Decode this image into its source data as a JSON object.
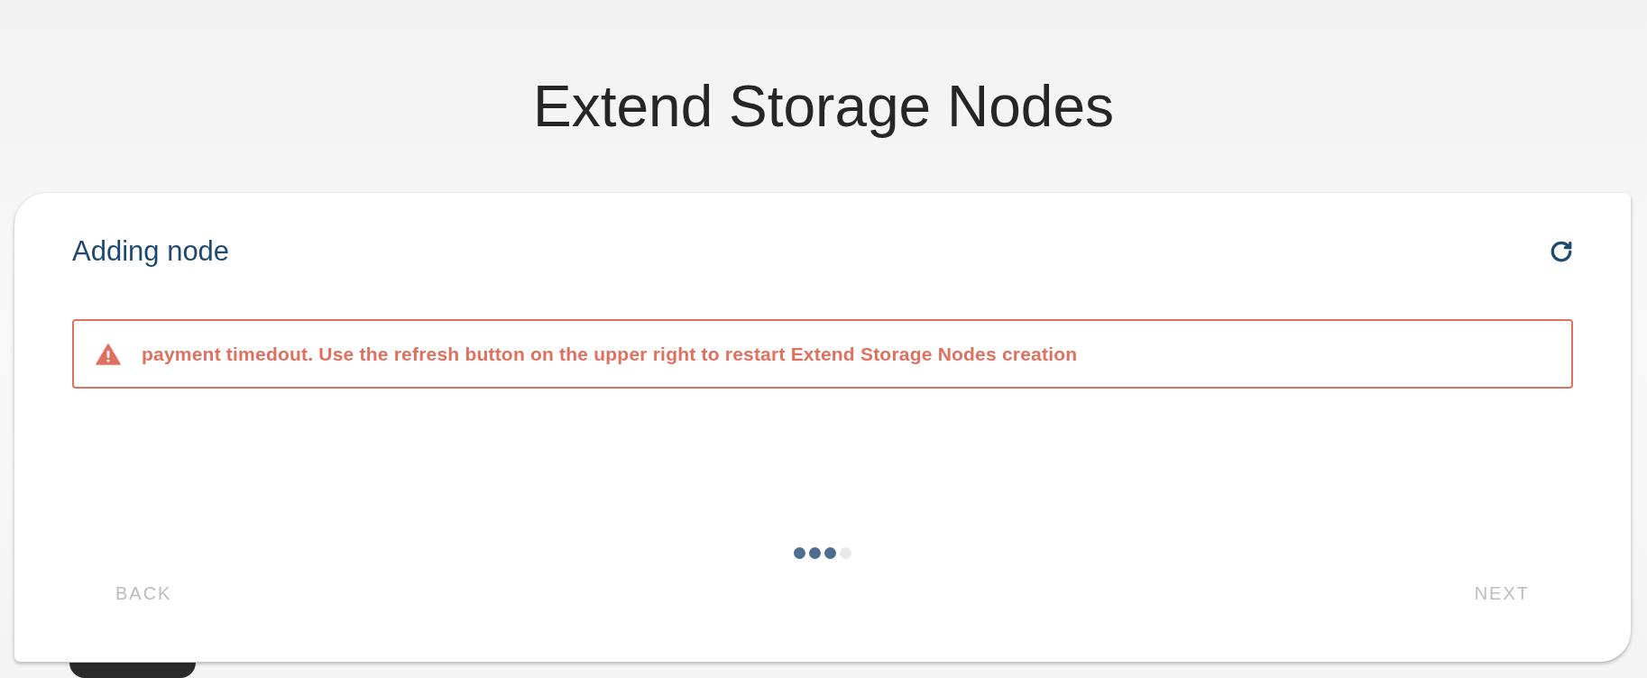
{
  "page": {
    "title": "Extend Storage Nodes"
  },
  "card": {
    "title": "Adding node"
  },
  "alert": {
    "kind": "error",
    "message": "payment timedout. Use the refresh button on the upper right to restart Extend Storage Nodes creation"
  },
  "steps": [
    {
      "completed": true
    },
    {
      "completed": true
    },
    {
      "completed": true
    },
    {
      "completed": false
    }
  ],
  "navigation": {
    "back": {
      "label": "BACK",
      "disabled": true
    },
    "next": {
      "label": "NEXT",
      "disabled": true
    }
  }
}
